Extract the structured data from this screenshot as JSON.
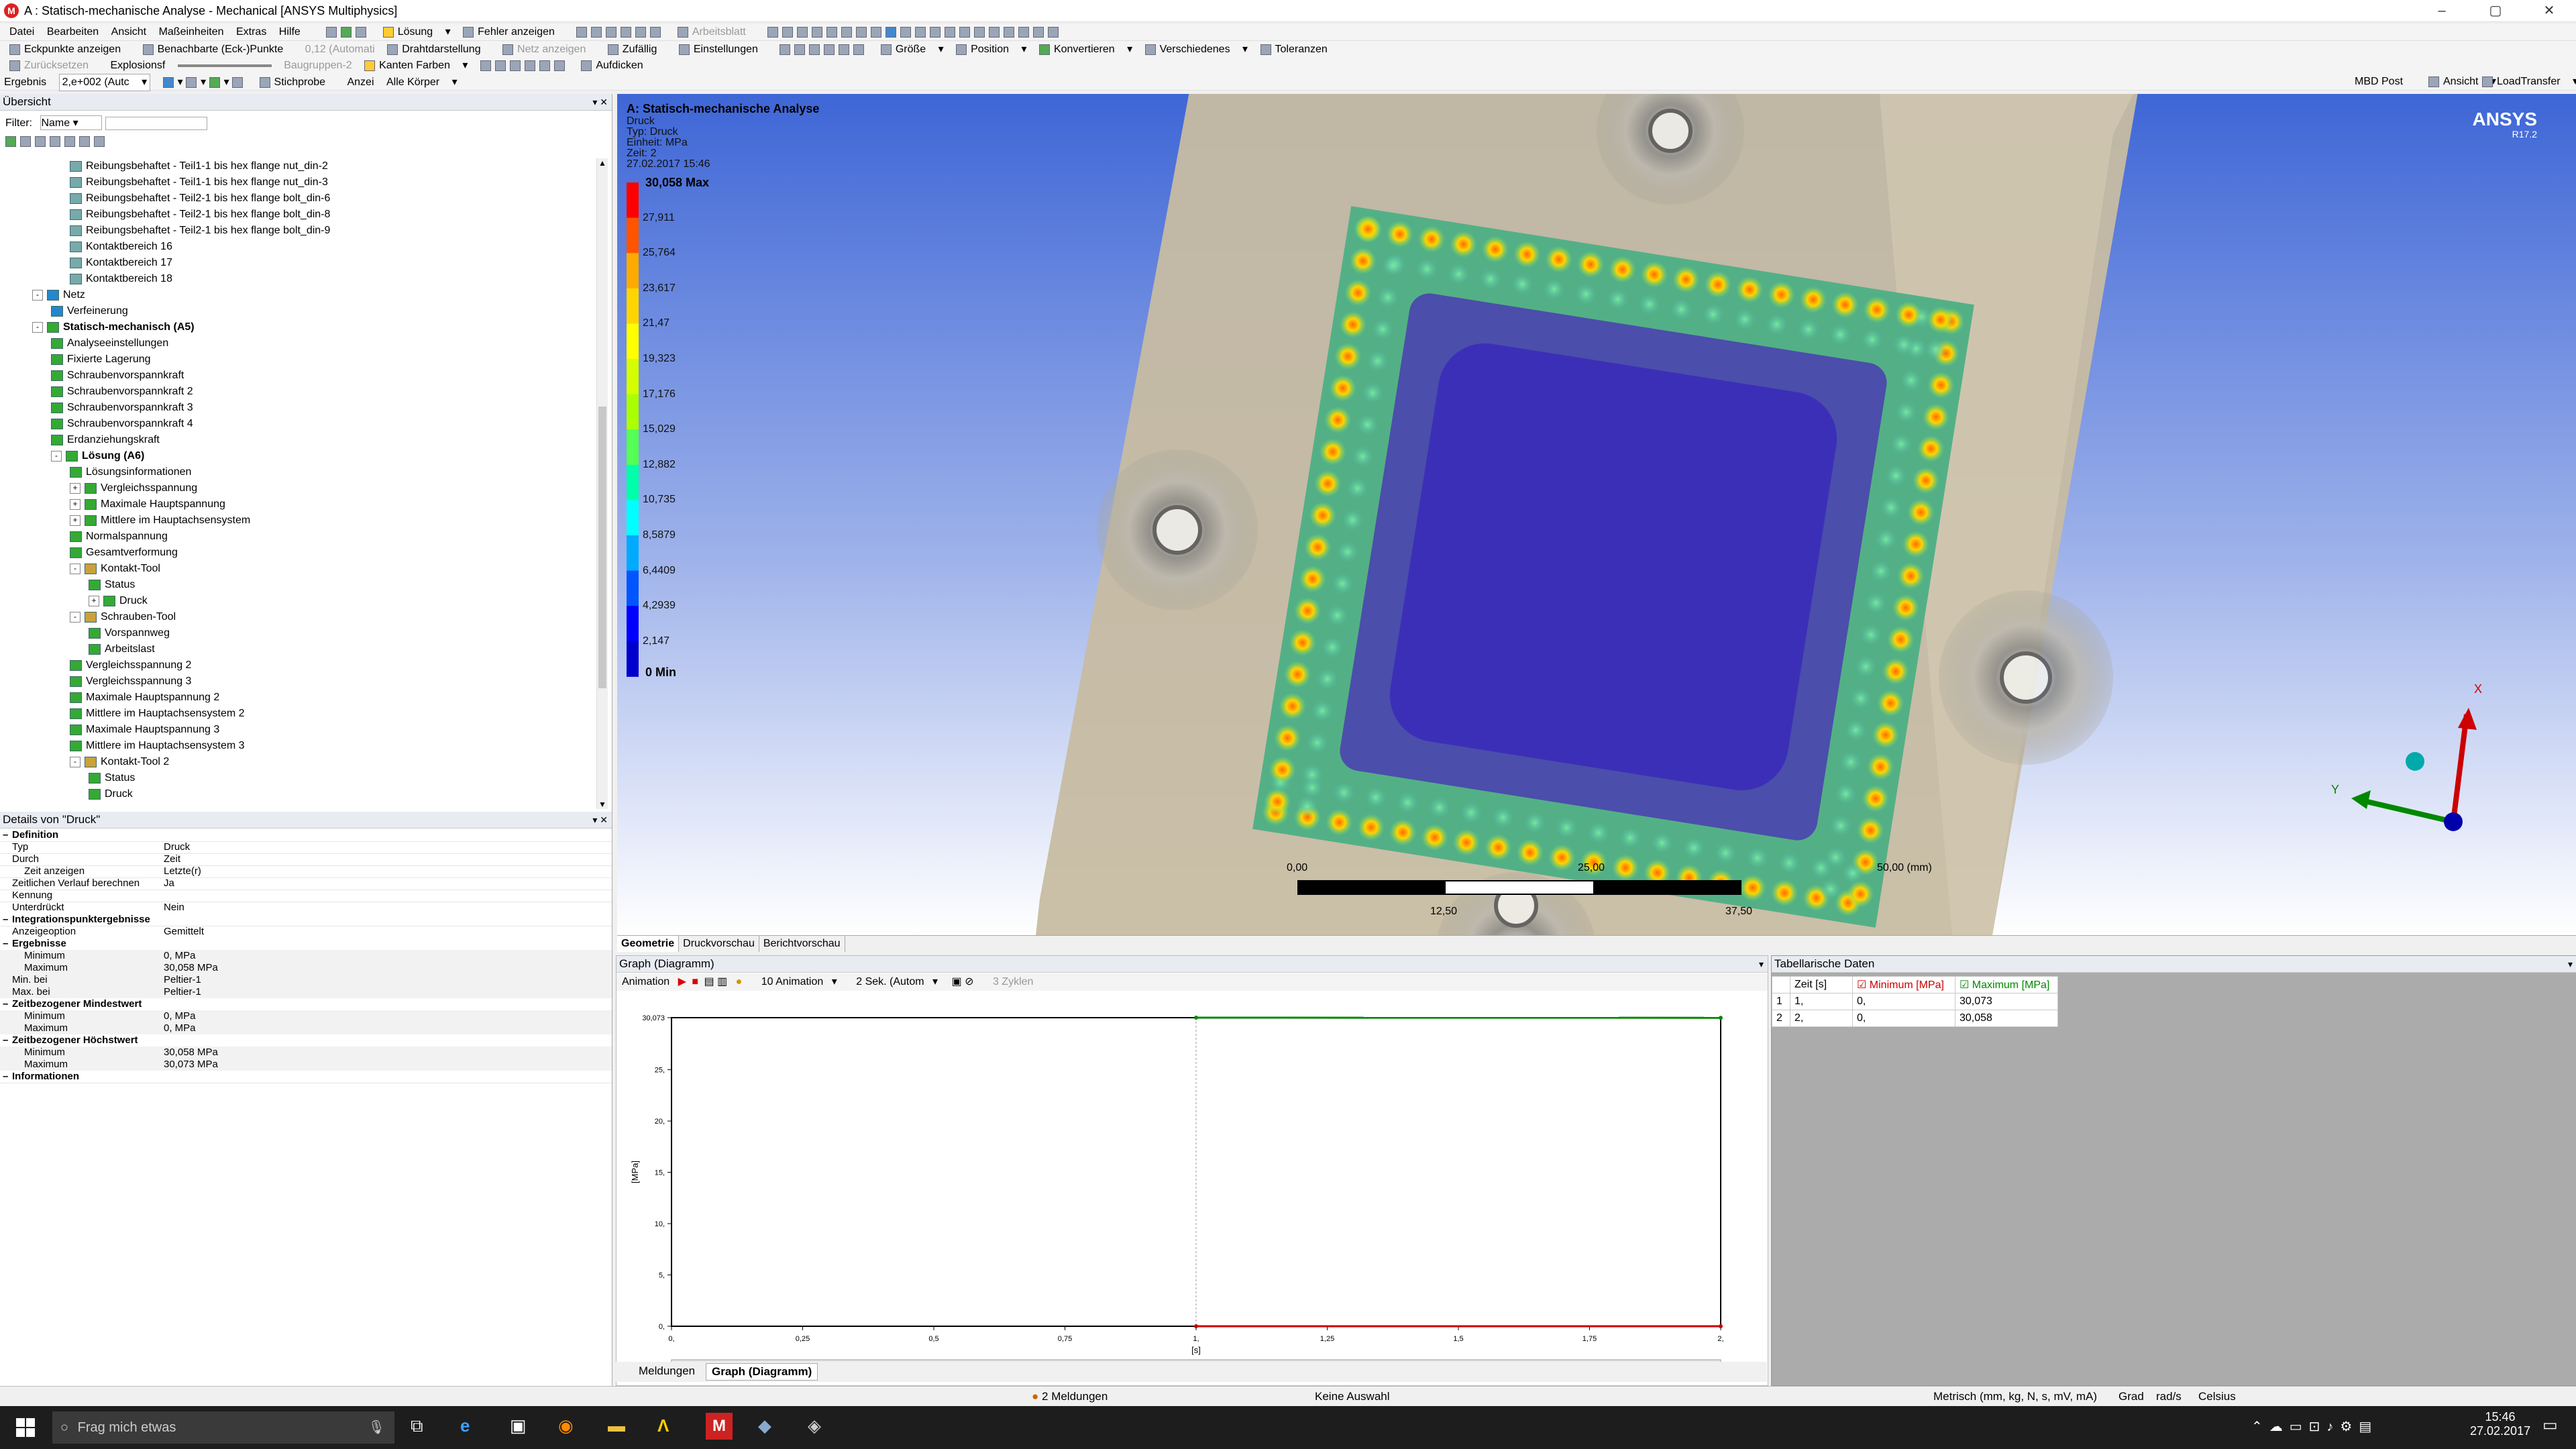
{
  "window": {
    "title": "A : Statisch-mechanische Analyse - Mechanical [ANSYS Multiphysics]",
    "logo_letter": "M",
    "controls": [
      "–",
      "▢",
      "✕"
    ]
  },
  "menu": [
    "Datei",
    "Bearbeiten",
    "Ansicht",
    "Maßeinheiten",
    "Extras",
    "Hilfe"
  ],
  "toolbar1": [
    "Lösung",
    "Fehler anzeigen",
    "Arbeitsblatt"
  ],
  "toolbar2": [
    "Eckpunkte anzeigen",
    "Benachbarte (Eck-)Punkte",
    "0,12 (Automati",
    "Drahtdarstellung",
    "Netz anzeigen",
    "Zufällig",
    "Einstellungen",
    "Größe",
    "Position",
    "Konvertieren",
    "Verschiedenes",
    "Toleranzen"
  ],
  "toolbar3": [
    "Zurücksetzen",
    "Explosionsf",
    "Baugruppen-2",
    "Kanten Farben",
    "Aufdicken"
  ],
  "toolbar4": {
    "ergebnis_label": "Ergebnis",
    "ergebnis_value": "2,e+002 (Autc",
    "stichprobe": "Stichprobe",
    "anzeigen_label": "Anzei",
    "anzeigen_value": "Alle Körper",
    "right": [
      "MBD Post",
      "Ansicht",
      "LoadTransfer"
    ]
  },
  "outline": {
    "header": "Übersicht",
    "filter_label": "Filter:",
    "filter_value": "Name",
    "items": [
      {
        "label": "Reibungsbehaftet - Teil1-1 bis hex flange nut_din-2",
        "indent": 3,
        "icon": "contact"
      },
      {
        "label": "Reibungsbehaftet - Teil1-1 bis hex flange nut_din-3",
        "indent": 3,
        "icon": "contact"
      },
      {
        "label": "Reibungsbehaftet - Teil2-1 bis hex flange bolt_din-6",
        "indent": 3,
        "icon": "contact"
      },
      {
        "label": "Reibungsbehaftet - Teil2-1 bis hex flange bolt_din-8",
        "indent": 3,
        "icon": "contact"
      },
      {
        "label": "Reibungsbehaftet - Teil2-1 bis hex flange bolt_din-9",
        "indent": 3,
        "icon": "contact"
      },
      {
        "label": "Kontaktbereich 16",
        "indent": 3,
        "icon": "contact"
      },
      {
        "label": "Kontaktbereich 17",
        "indent": 3,
        "icon": "contact"
      },
      {
        "label": "Kontaktbereich 18",
        "indent": 3,
        "icon": "contact"
      },
      {
        "label": "Netz",
        "indent": 1,
        "icon": "mesh",
        "exp": "-"
      },
      {
        "label": "Verfeinerung",
        "indent": 2,
        "icon": "mesh"
      },
      {
        "label": "Statisch-mechanisch (A5)",
        "indent": 1,
        "icon": "ok",
        "exp": "-",
        "bold": true
      },
      {
        "label": "Analyseeinstellungen",
        "indent": 2,
        "icon": "ok"
      },
      {
        "label": "Fixierte Lagerung",
        "indent": 2,
        "icon": "ok"
      },
      {
        "label": "Schraubenvorspannkraft",
        "indent": 2,
        "icon": "ok"
      },
      {
        "label": "Schraubenvorspannkraft 2",
        "indent": 2,
        "icon": "ok"
      },
      {
        "label": "Schraubenvorspannkraft 3",
        "indent": 2,
        "icon": "ok"
      },
      {
        "label": "Schraubenvorspannkraft 4",
        "indent": 2,
        "icon": "ok"
      },
      {
        "label": "Erdanziehungskraft",
        "indent": 2,
        "icon": "ok"
      },
      {
        "label": "Lösung (A6)",
        "indent": 2,
        "icon": "ok",
        "exp": "-",
        "bold": true
      },
      {
        "label": "Lösungsinformationen",
        "indent": 3,
        "icon": "ok"
      },
      {
        "label": "Vergleichsspannung",
        "indent": 3,
        "icon": "ok",
        "exp": "+"
      },
      {
        "label": "Maximale Hauptspannung",
        "indent": 3,
        "icon": "ok",
        "exp": "+"
      },
      {
        "label": "Mittlere im Hauptachsensystem",
        "indent": 3,
        "icon": "ok",
        "exp": "+"
      },
      {
        "label": "Normalspannung",
        "indent": 3,
        "icon": "ok"
      },
      {
        "label": "Gesamtverformung",
        "indent": 3,
        "icon": "ok"
      },
      {
        "label": "Kontakt-Tool",
        "indent": 3,
        "icon": "fol",
        "exp": "-"
      },
      {
        "label": "Status",
        "indent": 4,
        "icon": "ok"
      },
      {
        "label": "Druck",
        "indent": 4,
        "icon": "ok",
        "exp": "+"
      },
      {
        "label": "Schrauben-Tool",
        "indent": 3,
        "icon": "fol",
        "exp": "-"
      },
      {
        "label": "Vorspannweg",
        "indent": 4,
        "icon": "ok"
      },
      {
        "label": "Arbeitslast",
        "indent": 4,
        "icon": "ok"
      },
      {
        "label": "Vergleichsspannung 2",
        "indent": 3,
        "icon": "ok"
      },
      {
        "label": "Vergleichsspannung 3",
        "indent": 3,
        "icon": "ok"
      },
      {
        "label": "Maximale Hauptspannung 2",
        "indent": 3,
        "icon": "ok"
      },
      {
        "label": "Mittlere im Hauptachsensystem 2",
        "indent": 3,
        "icon": "ok"
      },
      {
        "label": "Maximale Hauptspannung 3",
        "indent": 3,
        "icon": "ok"
      },
      {
        "label": "Mittlere im Hauptachsensystem 3",
        "indent": 3,
        "icon": "ok"
      },
      {
        "label": "Kontakt-Tool 2",
        "indent": 3,
        "icon": "fol",
        "exp": "-"
      },
      {
        "label": "Status",
        "indent": 4,
        "icon": "ok"
      },
      {
        "label": "Druck",
        "indent": 4,
        "icon": "ok"
      }
    ]
  },
  "details": {
    "header": "Details von \"Druck\"",
    "rows": [
      {
        "type": "sec",
        "k": "Definition"
      },
      {
        "type": "row",
        "k": "Typ",
        "v": "Druck"
      },
      {
        "type": "row",
        "k": "Durch",
        "v": "Zeit"
      },
      {
        "type": "ind",
        "k": "Zeit anzeigen",
        "v": "Letzte(r)"
      },
      {
        "type": "row",
        "k": "Zeitlichen Verlauf berechnen",
        "v": "Ja"
      },
      {
        "type": "row",
        "k": "Kennung",
        "v": ""
      },
      {
        "type": "row",
        "k": "Unterdrückt",
        "v": "Nein"
      },
      {
        "type": "sec",
        "k": "Integrationspunktergebnisse"
      },
      {
        "type": "row",
        "k": "Anzeigeoption",
        "v": "Gemittelt"
      },
      {
        "type": "sec",
        "k": "Ergebnisse"
      },
      {
        "type": "ind sh",
        "k": "Minimum",
        "v": "0, MPa"
      },
      {
        "type": "ind sh",
        "k": "Maximum",
        "v": "30,058 MPa"
      },
      {
        "type": "row sh",
        "k": "Min. bei",
        "v": "Peltier-1"
      },
      {
        "type": "row sh",
        "k": "Max. bei",
        "v": "Peltier-1"
      },
      {
        "type": "sec",
        "k": "Zeitbezogener Mindestwert"
      },
      {
        "type": "ind sh",
        "k": "Minimum",
        "v": "0, MPa"
      },
      {
        "type": "ind sh",
        "k": "Maximum",
        "v": "0, MPa"
      },
      {
        "type": "sec",
        "k": "Zeitbezogener Höchstwert"
      },
      {
        "type": "ind sh",
        "k": "Minimum",
        "v": "30,058 MPa"
      },
      {
        "type": "ind sh",
        "k": "Maximum",
        "v": "30,073 MPa"
      },
      {
        "type": "sec",
        "k": "Informationen"
      }
    ]
  },
  "viewport": {
    "title": "A: Statisch-mechanische Analyse",
    "lines": [
      "Druck",
      "Typ: Druck",
      "Einheit: MPa",
      "Zeit: 2",
      "27.02.2017 15:46"
    ],
    "legend_max": "30,058 Max",
    "legend_min": "0 Min",
    "legend_ticks": [
      "27,911",
      "25,764",
      "23,617",
      "21,47",
      "19,323",
      "17,176",
      "15,029",
      "12,882",
      "10,735",
      "8,5879",
      "6,4409",
      "4,2939",
      "2,147"
    ],
    "legend_colors": [
      "#ff0000",
      "#ff5500",
      "#ffaa00",
      "#ffd500",
      "#ffff00",
      "#d4ff00",
      "#aaff00",
      "#55ff55",
      "#00ffaa",
      "#00ffff",
      "#00aaff",
      "#0055ff",
      "#0000ff",
      "#0000cc"
    ],
    "brand": "ANSYS",
    "version": "R17.2",
    "scale_top": [
      "0,00",
      "25,00",
      "50,00 (mm)"
    ],
    "scale_bottom": [
      "12,50",
      "37,50"
    ],
    "axis_x": "X",
    "axis_y": "Y"
  },
  "view_tabs": [
    "Geometrie",
    "Druckvorschau",
    "Berichtvorschau"
  ],
  "graph": {
    "header": "Graph (Diagramm)",
    "toolbar": [
      "Animation",
      "10 Animation",
      "2 Sek. (Autom",
      "3 Zyklen"
    ],
    "y_label": "[MPa]",
    "x_label": "[s]",
    "y_ticks": [
      "0,",
      "5,",
      "10,",
      "15,",
      "20,",
      "25,",
      "30,073"
    ],
    "x_ticks": [
      "0,",
      "0,25",
      "0,5",
      "0,75",
      "1,",
      "1,25",
      "1,5",
      "1,75",
      "2,"
    ],
    "steps": [
      "1",
      "2"
    ]
  },
  "chart_data": {
    "type": "line",
    "x": [
      1,
      2
    ],
    "series": [
      {
        "name": "Minimum [MPa]",
        "values": [
          0,
          0
        ],
        "color": "#cc0000"
      },
      {
        "name": "Maximum [MPa]",
        "values": [
          30.073,
          30.058
        ],
        "color": "#008800"
      }
    ],
    "xlabel": "[s]",
    "ylabel": "[MPa]",
    "xlim": [
      0,
      2
    ],
    "ylim": [
      0,
      30.073
    ]
  },
  "bottom_tabs": [
    "Meldungen",
    "Graph (Diagramm)"
  ],
  "tabular": {
    "header": "Tabellarische Daten",
    "columns": [
      "Zeit [s]",
      "Minimum [MPa]",
      "Maximum [MPa]"
    ],
    "rows": [
      [
        "1",
        "1,",
        "0,",
        "30,073"
      ],
      [
        "2",
        "2,",
        "0,",
        "30,058"
      ]
    ]
  },
  "status": {
    "messages": "2 Meldungen",
    "selection": "Keine Auswahl",
    "units": "Metrisch (mm, kg, N, s, mV, mA)",
    "angle": "Grad",
    "rot": "rad/s",
    "temp": "Celsius"
  },
  "taskbar": {
    "search_placeholder": "Frag mich etwas",
    "time": "15:46",
    "date": "27.02.2017"
  },
  "colors": {
    "viewport_top": "#3e66d6",
    "viewport_bottom": "#ffffff",
    "plate": "#c7bca2",
    "center": "#3b2fb8"
  }
}
